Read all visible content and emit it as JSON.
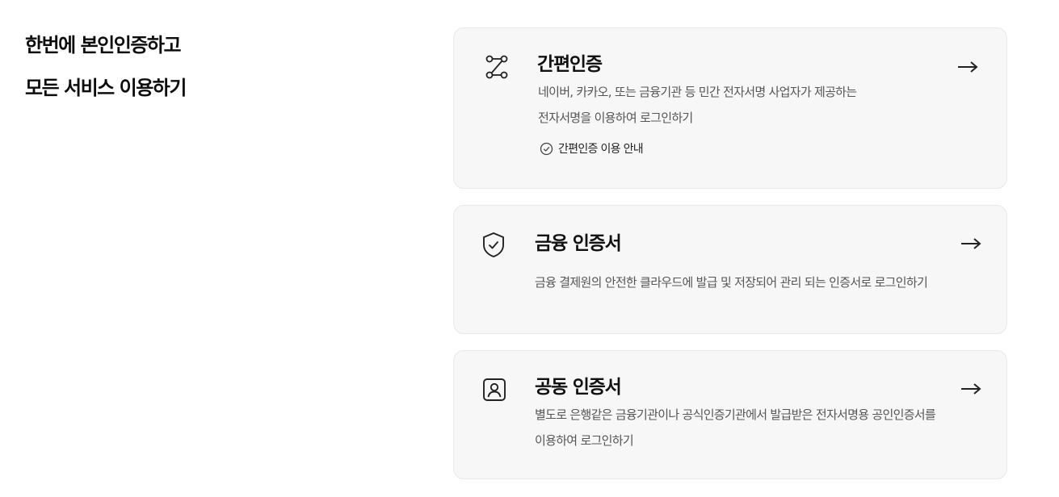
{
  "headline": {
    "line1": "한번에 본인인증하고",
    "line2": "모든 서비스 이용하기"
  },
  "cards": [
    {
      "icon": "route-nodes-icon",
      "title": "간편인증",
      "desc_lines": [
        "네이버, 카카오, 또는 금융기관 등 민간 전자서명 사업자가 제공하는",
        "전자서명을 이용하여 로그인하기"
      ],
      "guide_label": "간편인증 이용 안내",
      "guide_icon": "check-circle-icon",
      "arrow_icon": "arrow-right-icon"
    },
    {
      "icon": "shield-check-icon",
      "title": "금융 인증서",
      "desc_lines": [
        "금융 결제원의 안전한 클라우드에 발급 및 저장되어 관리 되는 인증서로 로그인하기"
      ],
      "arrow_icon": "arrow-right-icon"
    },
    {
      "icon": "user-badge-icon",
      "title": "공동 인증서",
      "desc_lines": [
        "별도로 은행같은 금융기관이나 공식인증기관에서 발급받은 전자서명용 공인인증서를",
        "이용하여 로그인하기"
      ],
      "arrow_icon": "arrow-right-icon"
    }
  ],
  "colors": {
    "card_bg": "#f7f7f7",
    "card_border": "#e9e9e9",
    "title": "#111111",
    "desc": "#555555"
  }
}
